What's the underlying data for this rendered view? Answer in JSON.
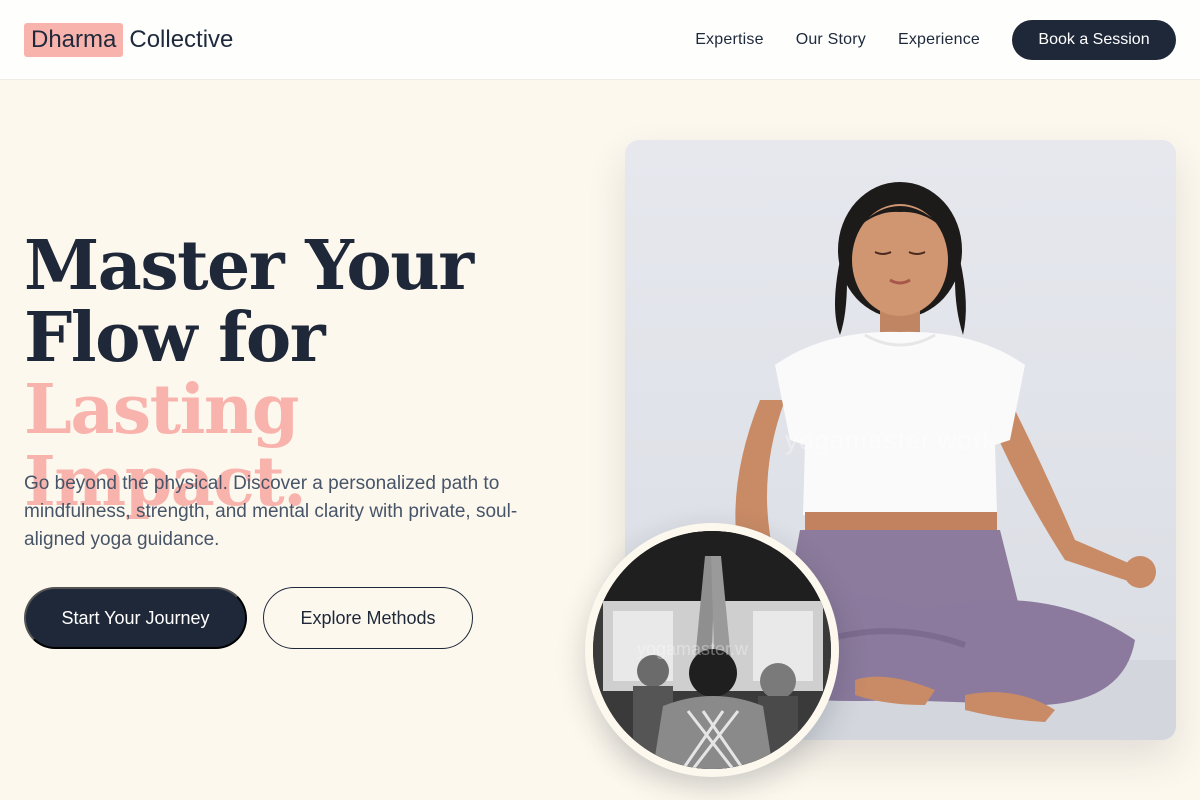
{
  "brand": {
    "name_highlight": "Dharma",
    "name_rest": "Collective",
    "accent_color": "#f9b3ad",
    "dark_color": "#1e2839"
  },
  "nav": {
    "items": [
      {
        "label": "Expertise"
      },
      {
        "label": "Our Story"
      },
      {
        "label": "Experience"
      }
    ],
    "cta_label": "Book a Session"
  },
  "hero": {
    "title_line1": "Master Your",
    "title_line2_plain": "Flow for ",
    "title_line2_accent": "Lasting",
    "title_line3_accent": "Impact.",
    "subtitle": "Go beyond the physical. Discover a personalized path to mindfulness, strength, and mental clarity with private, soul-aligned yoga guidance.",
    "primary_button": "Start Your Journey",
    "secondary_button": "Explore Methods"
  },
  "images": {
    "main_photo_watermark": "yogamaster.work",
    "inset_photo_watermark": "yogamaster.w"
  }
}
